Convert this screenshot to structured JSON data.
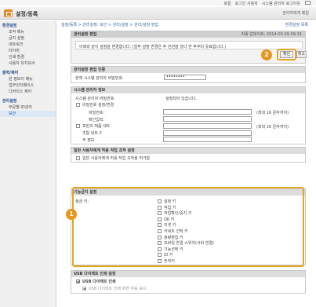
{
  "topbar": {
    "links": [
      "로컬",
      "로그인 사용자",
      "시스템 관리자 로그아웃"
    ]
  },
  "header": {
    "title": "설정/등록",
    "right_link": "관리자에게 메일"
  },
  "sidebar": {
    "groups": [
      {
        "title": "환경설정",
        "items": [
          "조작 메뉴",
          "급지 설정",
          "네트워크",
          "타이머",
          "인쇄 환경",
          "사용자 유지보수"
        ]
      },
      {
        "title": "출력/제어",
        "items": [
          "원 정보이 메뉴",
          "업무인터페이스",
          "디바이스 제어"
        ]
      },
      {
        "title": "관리설정",
        "items": [
          "부문별 ID관리",
          "보안"
        ]
      }
    ],
    "selected": "보안"
  },
  "breadcrumb": "설정/등록 > 관리설정: 보안 > 관리/설정 > 관리/설정 편집",
  "help_link": "환경설정 목록",
  "edit_panel": {
    "title": "관리설정 편집",
    "date": "최종 업데이트: 2014-03-29 09:15 ",
    "message": "아래와 같이 설정을 변경합니다. (일부 설정 변경은 주 전원을 껐다 켠 후부터 유효합니다.)",
    "ok_label": "확인",
    "cancel_label": "취소"
  },
  "auth_section": {
    "title": "관리설정 편집 인증",
    "label": "현재 시스템 관리자 비밀번호:",
    "password_value": "••••••••"
  },
  "sysinfo_section": {
    "title": "시스템 관리자 정보",
    "pin_label": "시스템 관리자 비밀번호:",
    "pin_status": "설정되어 있습니다.",
    "change_label": "비밀번호 설정/변경",
    "pin_field_label": "비밀번호:",
    "confirm_field_label": "확인입력:",
    "hint": "(최대 16 문자까지)",
    "hint2": "(최대 16 문자까지)",
    "item3_label": "포린의 제품 네트",
    "item4_label": "조합 네트 2",
    "item5_label": "주 정보"
  },
  "user_section": {
    "title": "일반 사용자에게 허용 작업 조작 설정",
    "checkbox_label": "일반 사용자에게 허용 작업 조작을 허가함"
  },
  "function_section": {
    "title": "기능금지 설정",
    "column_label": "정금 키:",
    "items": [
      "설정 키",
      "작업 키",
      "작업확인/중지 키",
      "OK 키",
      "리셋 키",
      "카세트 선택 키",
      "용량편집 키",
      "모바일 연결 스위치(서비 연결)",
      "기능선택 키",
      "ID 키",
      "숫자키"
    ]
  },
  "usb_section": {
    "title": "USB 다이렉트 인쇄 설정",
    "checkbox_label": "USB 다이렉트 인쇄",
    "sub_label": "USB 다이렉트 인쇄 화면 자동 표시"
  },
  "badges": {
    "one": "1",
    "two": "2"
  }
}
